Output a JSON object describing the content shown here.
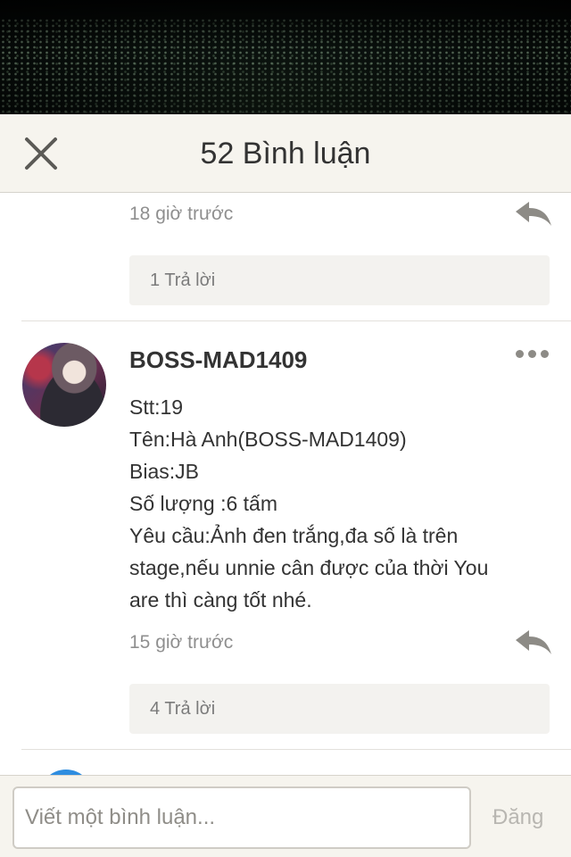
{
  "header": {
    "title": "52 Bình luận"
  },
  "prev_comment": {
    "time": "18 giờ trước",
    "replies": "1 Trả lời"
  },
  "comment": {
    "username": "BOSS-MAD1409",
    "lines": [
      "Stt:19",
      "Tên:Hà Anh(BOSS-MAD1409)",
      "Bias:JB",
      "Số lượng :6 tấm",
      "Yêu cầu:Ảnh đen trắng,đa số là trên",
      "stage,nếu unnie cân được của thời You",
      "are thì càng tốt nhé."
    ],
    "time": "15 giờ trước",
    "replies": "4 Trả lời"
  },
  "composer": {
    "placeholder": "Viết một bình luận...",
    "post_label": "Đăng"
  },
  "colors": {
    "header_bg": "#f6f4ee",
    "reply_box_bg": "#f3f2ef",
    "icon_gray": "#8d8b86"
  },
  "icons": {
    "close": "close-icon",
    "reply": "reply-arrow-icon",
    "more": "more-dots-icon"
  }
}
